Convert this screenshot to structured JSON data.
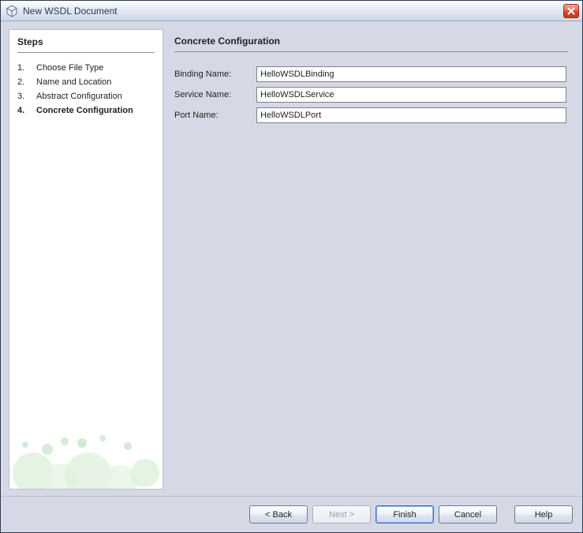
{
  "window": {
    "title": "New WSDL Document"
  },
  "steps": {
    "heading": "Steps",
    "items": [
      {
        "num": "1.",
        "label": "Choose File Type"
      },
      {
        "num": "2.",
        "label": "Name and Location"
      },
      {
        "num": "3.",
        "label": "Abstract Configuration"
      },
      {
        "num": "4.",
        "label": "Concrete Configuration"
      }
    ],
    "current_index": 3
  },
  "main": {
    "heading": "Concrete Configuration",
    "fields": {
      "binding": {
        "label": "Binding Name:",
        "value": "HelloWSDLBinding"
      },
      "service": {
        "label": "Service Name:",
        "value": "HelloWSDLService"
      },
      "port": {
        "label": "Port Name:",
        "value": "HelloWSDLPort"
      }
    }
  },
  "buttons": {
    "back": "< Back",
    "next": "Next >",
    "finish": "Finish",
    "cancel": "Cancel",
    "help": "Help"
  }
}
